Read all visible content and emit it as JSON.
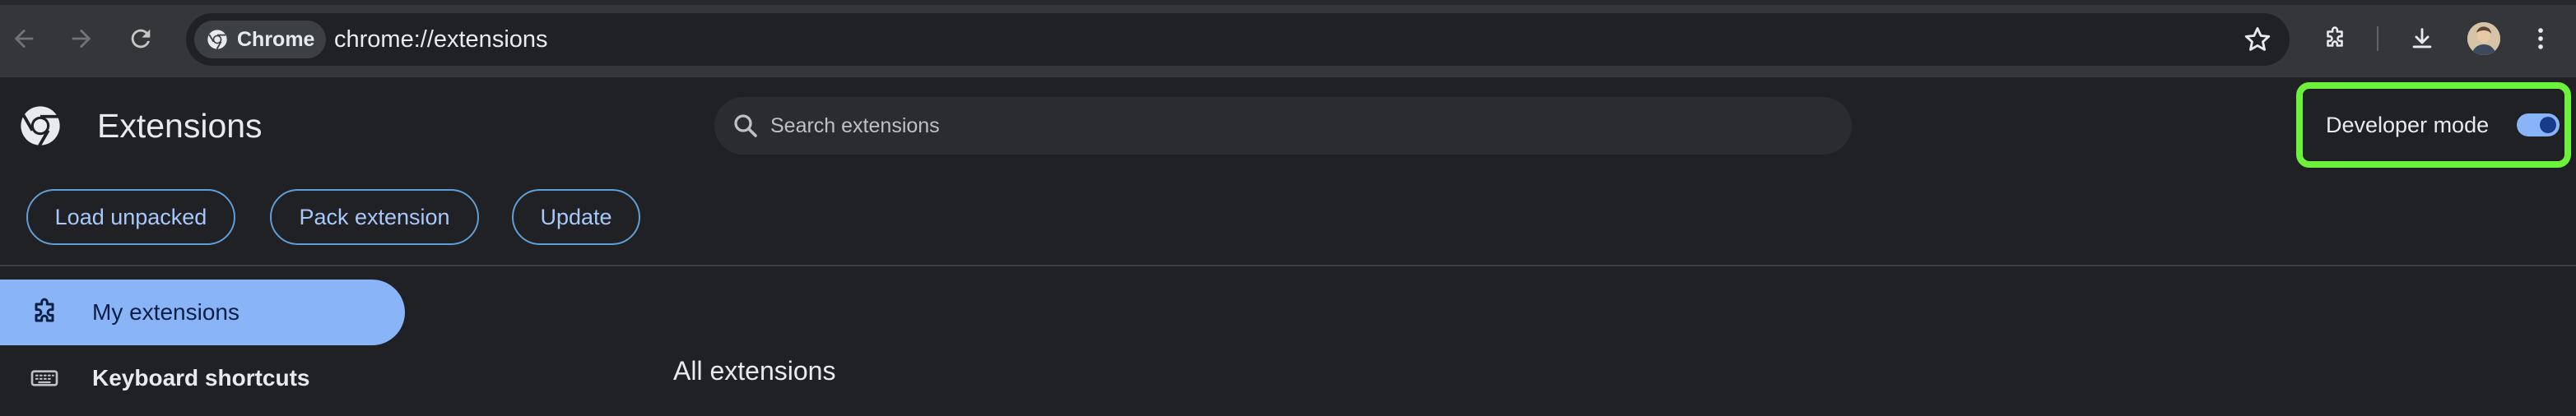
{
  "toolbar": {
    "site_chip_label": "Chrome",
    "url": "chrome://extensions",
    "icons": [
      "back-icon",
      "forward-icon",
      "reload-icon",
      "chrome-icon",
      "star-icon",
      "extensions-puzzle-icon",
      "download-icon",
      "avatar",
      "more-vert-icon"
    ]
  },
  "header": {
    "title": "Extensions",
    "search_placeholder": "Search extensions",
    "search_value": "",
    "developer_mode_label": "Developer mode",
    "developer_mode_on": true,
    "highlight_color": "#6cf23a"
  },
  "actions": {
    "load_unpacked": "Load unpacked",
    "pack_extension": "Pack extension",
    "update": "Update"
  },
  "sidebar": {
    "items": [
      {
        "label": "My extensions",
        "icon": "puzzle-icon",
        "active": true
      },
      {
        "label": "Keyboard shortcuts",
        "icon": "keyboard-icon",
        "active": false
      }
    ]
  },
  "main": {
    "section_title": "All extensions"
  },
  "colors": {
    "background": "#202124",
    "toolbar": "#35363a",
    "accent": "#8ab4f8",
    "button_text": "#a8c7fa"
  }
}
